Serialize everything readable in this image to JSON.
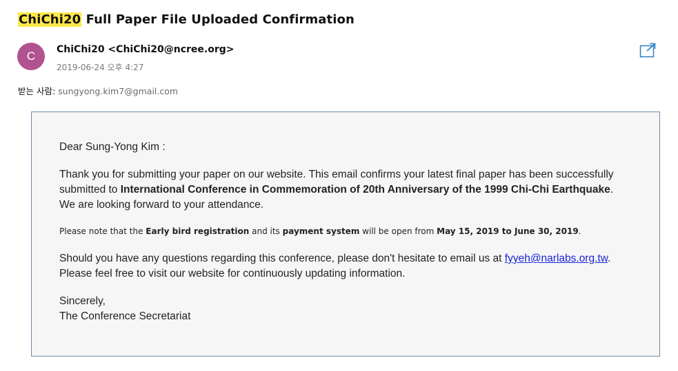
{
  "email": {
    "subject_highlight": "ChiChi20",
    "subject_rest": " Full Paper File Uploaded Confirmation",
    "avatar_letter": "C",
    "sender": "ChiChi20 <ChiChi20@ncree.org>",
    "date": "2019-06-24 오후 4:27",
    "recipients_label": "받는 사람: ",
    "recipients_value": "sungyong.kim7@gmail.com"
  },
  "message": {
    "salutation": "Dear Sung-Yong Kim :",
    "body1_a": "Thank you for submitting your paper on our website. This email confirms your latest final paper has been successfully submitted to ",
    "body1_conf": "International Conference in Commemoration of 20th Anniversary of the 1999 Chi-Chi Earthquake",
    "body1_b": ". We are looking forward to your attendance.",
    "note_a": "Please note that the ",
    "note_b1": "Early bird registration",
    "note_c": " and its ",
    "note_b2": "payment system",
    "note_d": " will be open from ",
    "note_b3": "May 15, 2019 to June 30, 2019",
    "note_e": ".",
    "body2_a": "Should you have any questions regarding this conference, please don't hesitate to email us at ",
    "body2_link": "fyyeh@narlabs.org.tw",
    "body2_b": ". Please feel free to visit our website for continuously updating information.",
    "closing": "Sincerely,",
    "signature": "The Conference Secretariat"
  },
  "colors": {
    "highlight": "#ffe84a",
    "avatar": "#b1538f",
    "link": "#1a23d6",
    "box_border": "#6f8ba3"
  },
  "icons": {
    "popout": "open-in-new-window-icon"
  }
}
